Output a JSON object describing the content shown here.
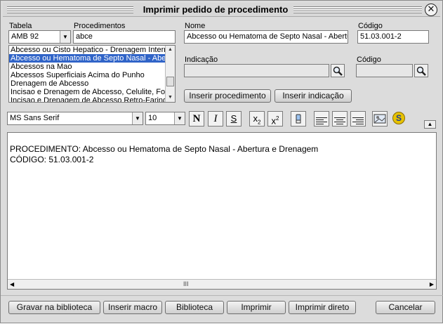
{
  "dialog": {
    "title": "Imprimir pedido de procedimento"
  },
  "left": {
    "tabela_label": "Tabela",
    "tabela_value": "AMB 92",
    "procedimentos_label": "Procedimentos",
    "search_value": "abce",
    "list": [
      "Abcesso ou Cisto Hepatico - Drenagem Interna",
      "Abcesso ou Hematoma de Septo Nasal - Abertura",
      "Abcessos na Mao",
      "Abcessos Superficiais Acima do Punho",
      "Drenagem de Abcesso",
      "Incisao e Drenagem de Abcesso, Celulite, Folic",
      "Incisao e Drenagem de Abcesso Retro-Faringeo"
    ],
    "selected_index": 1
  },
  "right": {
    "nome_label": "Nome",
    "nome_value": "Abcesso ou Hematoma de Septo Nasal - Abertur",
    "codigo_label": "Código",
    "codigo_value": "51.03.001-2",
    "indicacao_label": "Indicação",
    "indicacao_value": "",
    "codigo2_label": "Código",
    "codigo2_value": "",
    "inserir_procedimento": "Inserir procedimento",
    "inserir_indicacao": "Inserir indicação"
  },
  "toolbar": {
    "font_name": "MS Sans Serif",
    "font_size": "10",
    "bold": "N",
    "italic": "I",
    "underline": "S",
    "subscript_base": "x",
    "subscript_mark": "2",
    "superscript_base": "x",
    "superscript_mark": "2",
    "spell_icon": "S"
  },
  "editor": {
    "line1": "PROCEDIMENTO: Abcesso ou Hematoma de Septo Nasal - Abertura e Drenagem",
    "line2": "CÓDIGO: 51.03.001-2",
    "hscroll_grip": "III"
  },
  "buttons": {
    "gravar": "Gravar na biblioteca",
    "macro": "Inserir macro",
    "biblioteca": "Biblioteca",
    "imprimir": "Imprimir",
    "imprimir_direto": "Imprimir direto",
    "cancelar": "Cancelar"
  },
  "icons": {
    "close": "close-icon",
    "search": "magnifier-icon",
    "erase": "eraser-icon",
    "image": "insert-image-icon",
    "spellcheck": "spellcheck-icon",
    "collapse": "collapse-up-icon"
  }
}
